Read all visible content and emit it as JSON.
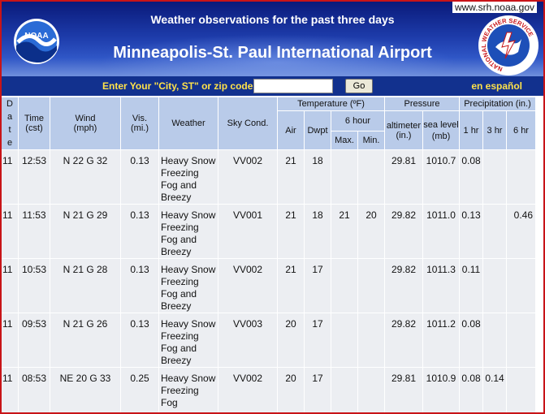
{
  "header": {
    "url": "www.srh.noaa.gov",
    "subtitle": "Weather observations for the past three days",
    "title": "Minneapolis-St. Paul International Airport",
    "noaa_logo_text": "NOAA",
    "nws_logo_text": "NATIONAL WEATHER SERVICE"
  },
  "search": {
    "label": "Enter Your \"City, ST\" or zip code",
    "value": "",
    "go_label": "Go",
    "espanol_label": "en español"
  },
  "colors": {
    "banner_dark": "#0a1a7a",
    "banner_light": "#6f8fdc",
    "search_bar": "#12318e",
    "search_text": "#ffe24a",
    "header_cell": "#b9cbe9",
    "data_cell": "#eceef2",
    "window_border": "#c81418"
  },
  "table": {
    "headers": {
      "date": "Date",
      "time": "Time (cst)",
      "wind": "Wind (mph)",
      "vis": "Vis. (mi.)",
      "weather": "Weather",
      "sky": "Sky Cond.",
      "temperature": "Temperature (ºF)",
      "air": "Air",
      "dwpt": "Dwpt",
      "six_hour": "6 hour",
      "max": "Max.",
      "min": "Min.",
      "pressure": "Pressure",
      "altimeter": "altimeter (in.)",
      "sea_level": "sea level (mb)",
      "precipitation": "Precipitation (in.)",
      "p1": "1 hr",
      "p3": "3 hr",
      "p6": "6 hr"
    },
    "rows": [
      {
        "date": "11",
        "time": "12:53",
        "wind": "N 22 G 32",
        "vis": "0.13",
        "weather": "Heavy Snow Freezing Fog and Breezy",
        "sky": "VV002",
        "air": "21",
        "dwpt": "18",
        "max": "",
        "min": "",
        "altimeter": "29.81",
        "sea_level": "1010.7",
        "p1": "0.08",
        "p3": "",
        "p6": ""
      },
      {
        "date": "11",
        "time": "11:53",
        "wind": "N 21 G 29",
        "vis": "0.13",
        "weather": "Heavy Snow Freezing Fog and Breezy",
        "sky": "VV001",
        "air": "21",
        "dwpt": "18",
        "max": "21",
        "min": "20",
        "altimeter": "29.82",
        "sea_level": "1011.0",
        "p1": "0.13",
        "p3": "",
        "p6": "0.46"
      },
      {
        "date": "11",
        "time": "10:53",
        "wind": "N 21 G 28",
        "vis": "0.13",
        "weather": "Heavy Snow Freezing Fog and Breezy",
        "sky": "VV002",
        "air": "21",
        "dwpt": "17",
        "max": "",
        "min": "",
        "altimeter": "29.82",
        "sea_level": "1011.3",
        "p1": "0.11",
        "p3": "",
        "p6": ""
      },
      {
        "date": "11",
        "time": "09:53",
        "wind": "N 21 G 26",
        "vis": "0.13",
        "weather": "Heavy Snow Freezing Fog and Breezy",
        "sky": "VV003",
        "air": "20",
        "dwpt": "17",
        "max": "",
        "min": "",
        "altimeter": "29.82",
        "sea_level": "1011.2",
        "p1": "0.08",
        "p3": "",
        "p6": ""
      },
      {
        "date": "11",
        "time": "08:53",
        "wind": "NE 20 G 33",
        "vis": "0.25",
        "weather": "Heavy Snow Freezing Fog",
        "sky": "VV002",
        "air": "20",
        "dwpt": "17",
        "max": "",
        "min": "",
        "altimeter": "29.81",
        "sea_level": "1010.9",
        "p1": "0.08",
        "p3": "0.14",
        "p6": ""
      }
    ]
  }
}
